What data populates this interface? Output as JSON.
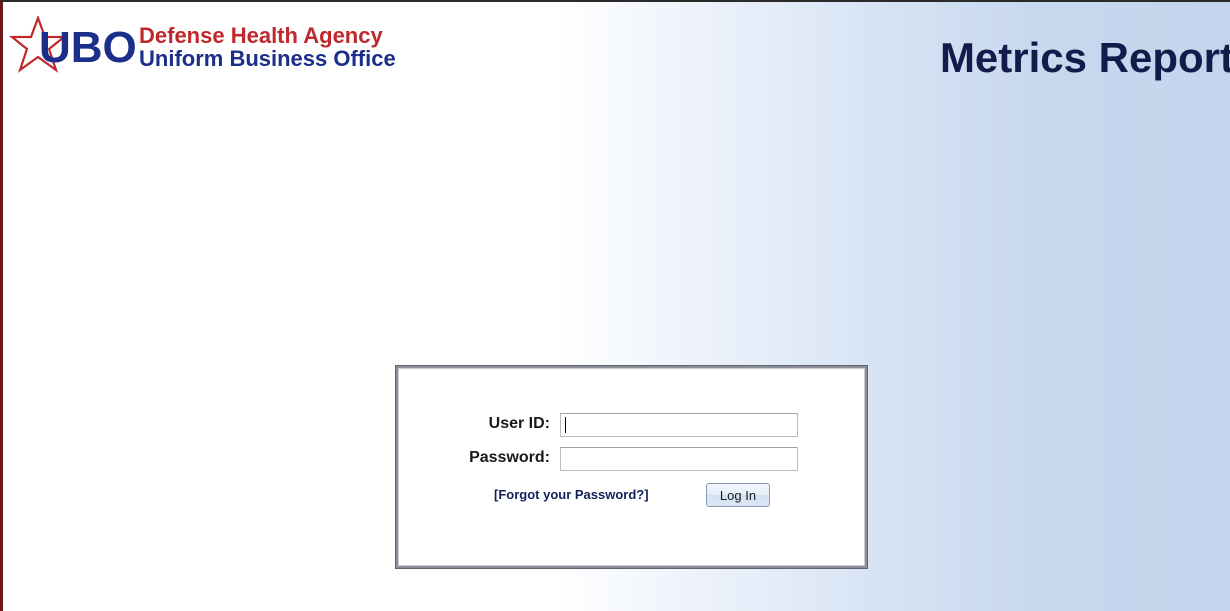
{
  "header": {
    "logo": {
      "acronym": "UBO",
      "agency": "Defense Health Agency",
      "office": "Uniform Business Office"
    },
    "title": "Metrics Report"
  },
  "login_form": {
    "user_id": {
      "label": "User ID:",
      "value": ""
    },
    "password": {
      "label": "Password:",
      "value": ""
    },
    "forgot_link": "[Forgot your Password?]",
    "submit_label": "Log In"
  },
  "colors": {
    "brand_blue": "#1b2f8a",
    "brand_red": "#c0282d",
    "title_navy": "#121c4a",
    "frame_left": "#6a1818"
  }
}
